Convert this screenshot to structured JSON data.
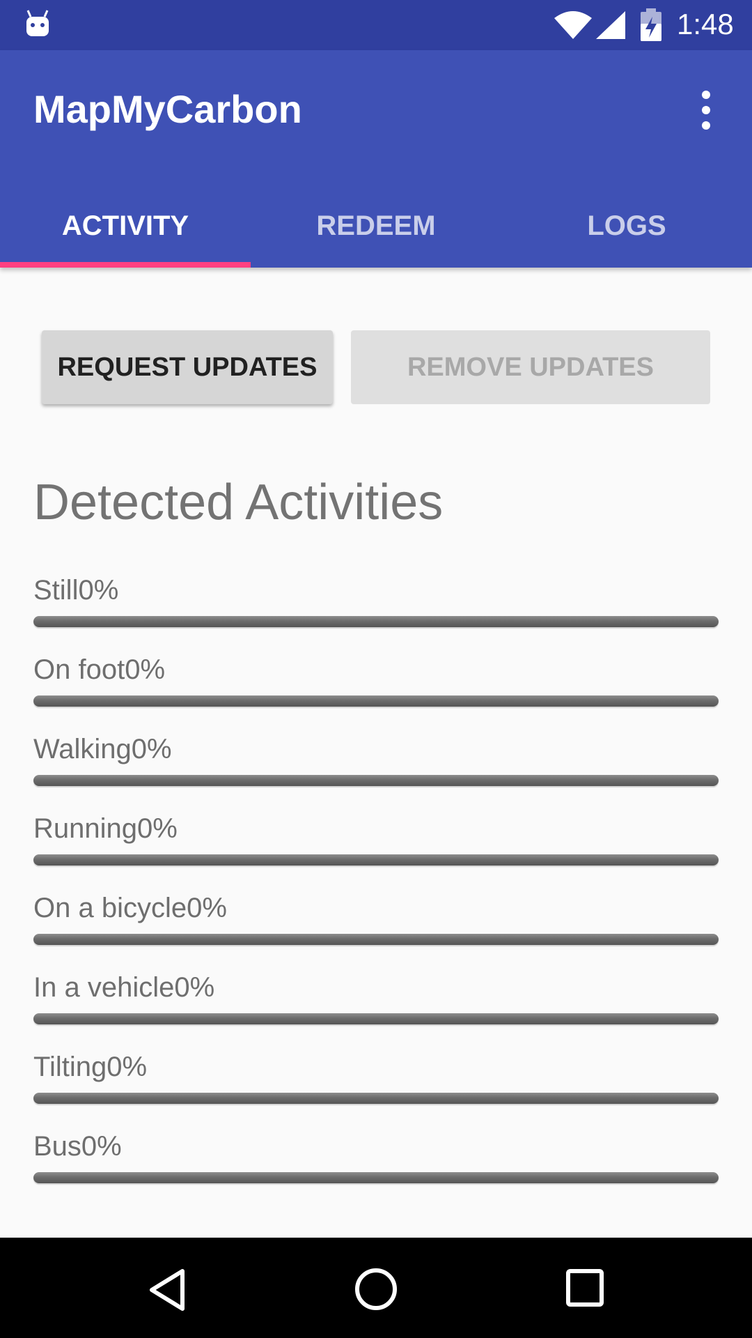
{
  "status_bar": {
    "time": "1:48",
    "icons": [
      "android-icon",
      "wifi-icon",
      "signal-icon",
      "battery-charging-icon"
    ]
  },
  "app_bar": {
    "title": "MapMyCarbon",
    "menu_icon": "more-vert-icon",
    "tabs": [
      {
        "label": "ACTIVITY",
        "selected": true
      },
      {
        "label": "REDEEM",
        "selected": false
      },
      {
        "label": "LOGS",
        "selected": false
      }
    ]
  },
  "buttons": {
    "request_updates": "REQUEST UPDATES",
    "remove_updates": "REMOVE UPDATES",
    "remove_updates_enabled": false
  },
  "section_title": "Detected Activities",
  "activities": [
    {
      "label": "Still0%",
      "progress": 0
    },
    {
      "label": "On foot0%",
      "progress": 0
    },
    {
      "label": "Walking0%",
      "progress": 0
    },
    {
      "label": "Running0%",
      "progress": 0
    },
    {
      "label": "On a bicycle0%",
      "progress": 0
    },
    {
      "label": "In a vehicle0%",
      "progress": 0
    },
    {
      "label": "Tilting0%",
      "progress": 0
    },
    {
      "label": "Bus0%",
      "progress": 0
    }
  ],
  "nav_bar": {
    "icons": [
      "back-icon",
      "home-icon",
      "recent-apps-icon"
    ]
  },
  "colors": {
    "primary": "#3f51b5",
    "primary_dark": "#303f9f",
    "accent": "#ff4081"
  }
}
